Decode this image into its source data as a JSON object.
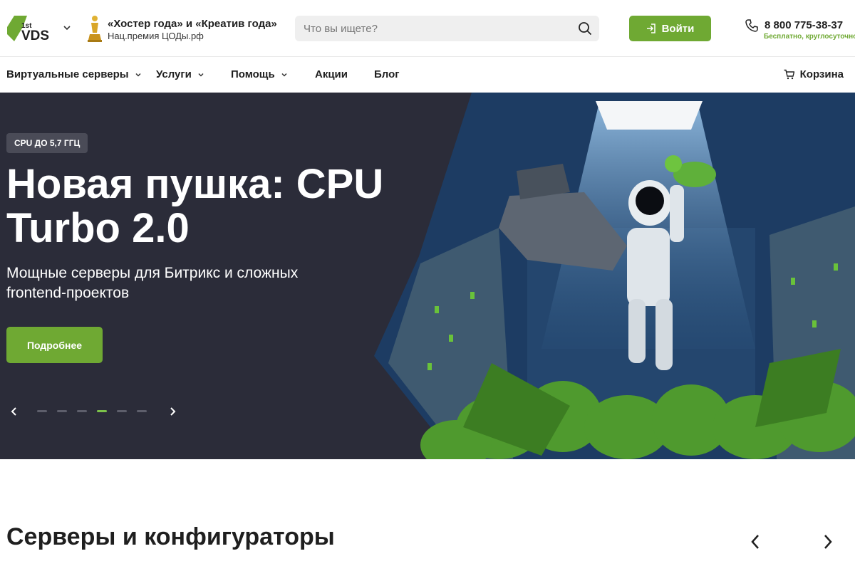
{
  "header": {
    "logo_text": "1st VDS",
    "award_title": "«Хостер года» и «Креатив года»",
    "award_subtitle": "Нац.премия ЦОДы.рф",
    "search_placeholder": "Что вы ищете?",
    "login_label": "Войти",
    "phone": "8 800 775-38-37",
    "phone_note": "Бесплатно, круглосуточно"
  },
  "nav": {
    "items": [
      {
        "label": "Виртуальные серверы",
        "has_dropdown": true
      },
      {
        "label": "Услуги",
        "has_dropdown": true
      },
      {
        "label": "Помощь",
        "has_dropdown": true
      },
      {
        "label": "Акции",
        "has_dropdown": false
      },
      {
        "label": "Блог",
        "has_dropdown": false
      }
    ],
    "cart_label": "Корзина"
  },
  "hero": {
    "badge": "CPU ДО 5,7 ГГЦ",
    "title": "Новая пушка: CPU Turbo 2.0",
    "subtitle": "Мощные серверы для Битрикс и сложных frontend-проектов",
    "button_label": "Подробнее",
    "slides_total": 6,
    "active_slide": 4
  },
  "section": {
    "title": "Серверы и конфигураторы"
  },
  "colors": {
    "brand_green": "#6fa933",
    "hero_bg": "#2b2c39",
    "active_dot": "#7cc24a"
  },
  "icons": {
    "logo": "vds-logo",
    "award": "trophy-icon",
    "search": "search-icon",
    "login": "login-icon",
    "phone": "phone-icon",
    "cart": "cart-icon"
  }
}
